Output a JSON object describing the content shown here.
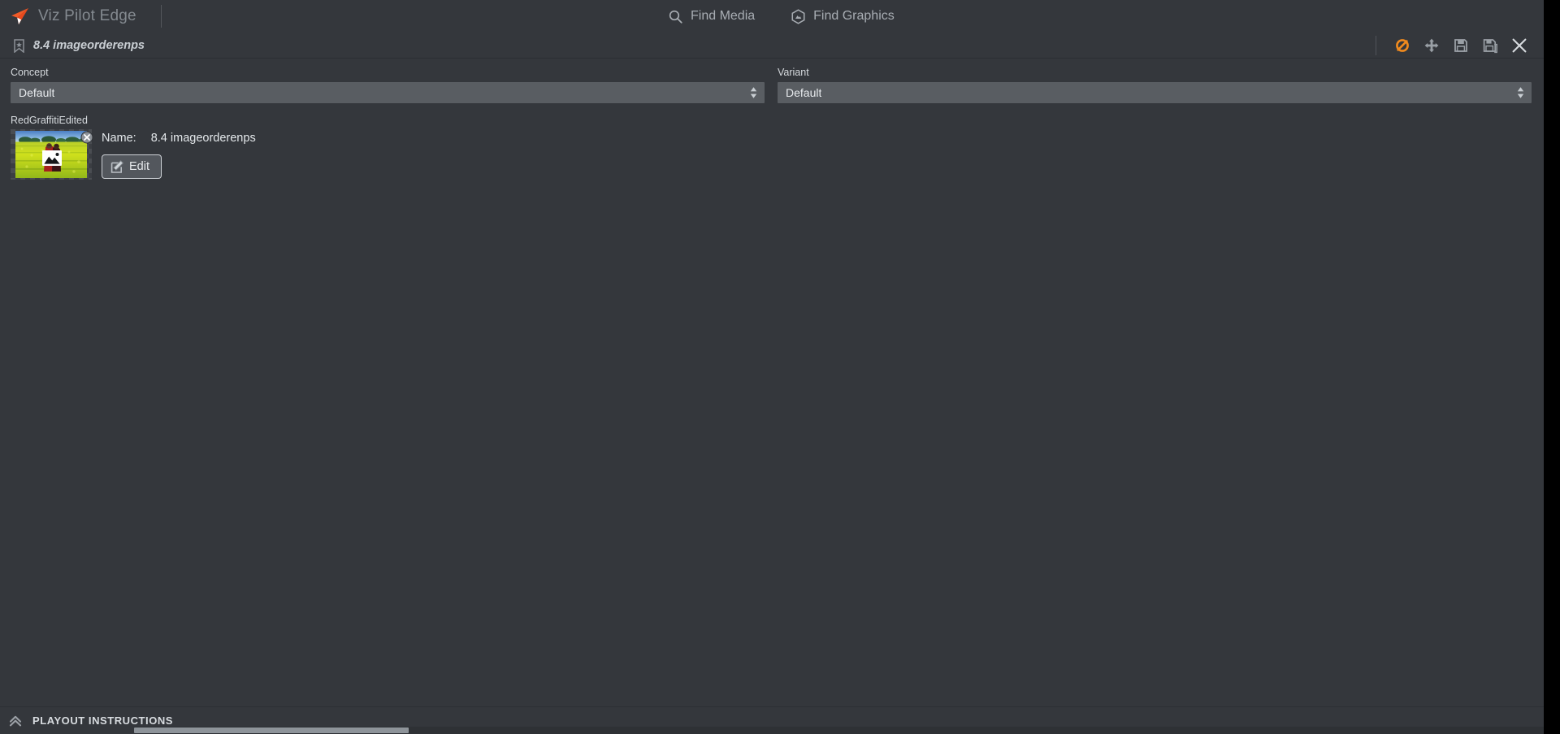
{
  "app": {
    "brand_name": "Viz Pilot Edge",
    "logo_icon": "paper-plane-icon",
    "accent_color": "#f05a28",
    "background_color": "#34373c",
    "field_color": "#595d62"
  },
  "header": {
    "find_media": {
      "label": "Find Media",
      "icon": "search-icon"
    },
    "find_graphics": {
      "label": "Find Graphics",
      "icon": "hexagon-graphics-icon"
    }
  },
  "title_bar": {
    "bookmark_icon": "bookmark-star-icon",
    "document_title": "8.4 imageorderenps",
    "tools": [
      {
        "name": "toggle-visibility-button",
        "icon": "circle-slash-icon",
        "color": "#f08a1e",
        "title": "Hidden"
      },
      {
        "name": "move-button",
        "icon": "move-arrows-icon",
        "color": "#9aa0a6",
        "title": "Move"
      },
      {
        "name": "save-button",
        "icon": "floppy-save-icon",
        "color": "#9aa0a6",
        "title": "Save"
      },
      {
        "name": "save-as-button",
        "icon": "floppy-save-as-icon",
        "color": "#9aa0a6",
        "title": "Save As"
      },
      {
        "name": "close-button",
        "icon": "close-x-icon",
        "color": "#d7dbdf",
        "title": "Close"
      }
    ]
  },
  "selectors": {
    "concept": {
      "label": "Concept",
      "value": "Default",
      "spinner_icon": "spinner-updown-icon"
    },
    "variant": {
      "label": "Variant",
      "value": "Default",
      "spinner_icon": "spinner-updown-icon"
    }
  },
  "media": {
    "group_label": "RedGraffitiEdited",
    "thumbnail": {
      "alt": "canola-field-with-people-thumbnail",
      "placeholder_icon": "broken-image-icon",
      "remove_icon": "remove-x-icon"
    },
    "name_label": "Name:",
    "name_value": "8.4 imageorderenps",
    "edit_button": {
      "label": "Edit",
      "icon": "pencil-edit-icon"
    }
  },
  "footer": {
    "playout_label": "PLAYOUT INSTRUCTIONS",
    "collapse_icon": "double-chevron-up-icon"
  }
}
